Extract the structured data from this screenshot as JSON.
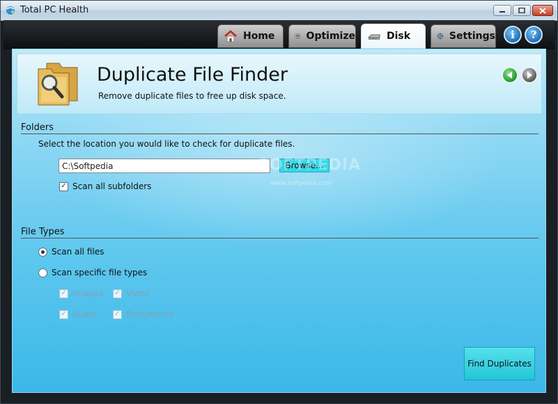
{
  "window": {
    "title": "Total PC Health"
  },
  "tabs": [
    {
      "label": "Home",
      "icon": "home-icon"
    },
    {
      "label": "Optimize",
      "icon": "optimize-icon"
    },
    {
      "label": "Disk",
      "icon": "disk-icon",
      "active": true
    },
    {
      "label": "Settings",
      "icon": "settings-icon"
    }
  ],
  "toolbar_buttons": {
    "info": "i",
    "help": "?"
  },
  "header": {
    "title": "Duplicate File Finder",
    "subtitle": "Remove duplicate files to free up disk space."
  },
  "folders": {
    "section_title": "Folders",
    "description": "Select the location you would like to check for duplicate files.",
    "path_value": "C:\\Softpedia",
    "browse_label": "Browse...",
    "scan_subfolders_label": "Scan all subfolders",
    "scan_subfolders_checked": true
  },
  "file_types": {
    "section_title": "File Types",
    "scan_all_label": "Scan all files",
    "scan_specific_label": "Scan specific file types",
    "selected": "scan_all",
    "types": [
      {
        "label": "Images",
        "checked": true
      },
      {
        "label": "Video",
        "checked": true
      },
      {
        "label": "Audio",
        "checked": true
      },
      {
        "label": "Documents",
        "checked": true
      }
    ]
  },
  "actions": {
    "find_duplicates_label": "Find Duplicates"
  },
  "watermark": {
    "main": "SOFTPEDIA",
    "small": "www.softpedia.com"
  },
  "colors": {
    "panel_accent": "#3ab8e8",
    "button_cyan": "#35d8e8"
  }
}
